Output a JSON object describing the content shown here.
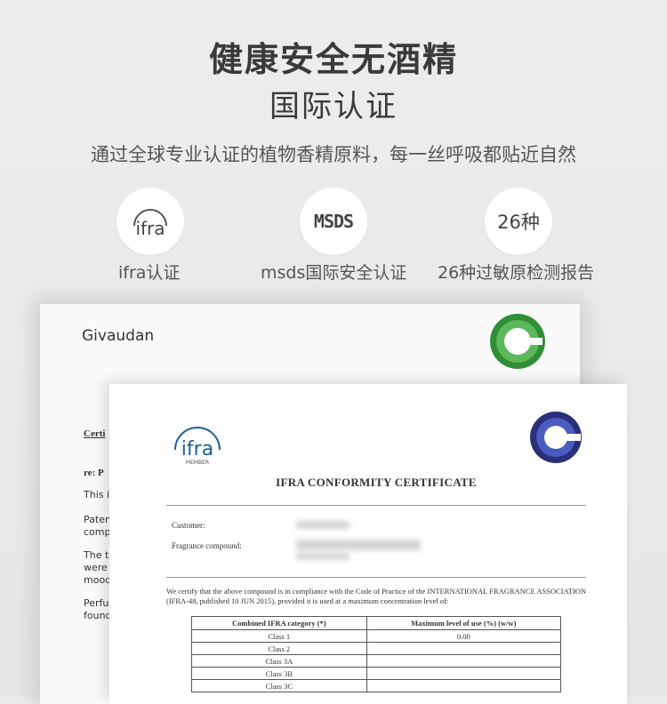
{
  "header": {
    "title": "健康安全无酒精",
    "subtitle": "国际认证",
    "description": "通过全球专业认证的植物香精原料，每一丝呼吸都贴近自然"
  },
  "badges": [
    {
      "icon_text": "ifra",
      "label": "ifra认证"
    },
    {
      "icon_text": "MSDS",
      "label": "msds国际安全认证"
    },
    {
      "icon_text": "26种",
      "label": "26种过敏原检测报告"
    }
  ],
  "back_certificate": {
    "company": "Givaudan",
    "fragments": [
      "Certi",
      "re: P",
      "This i",
      "Paten",
      "comp",
      "The t",
      "were",
      "mood",
      "Perfu",
      "found"
    ]
  },
  "front_certificate": {
    "logo_text": "ifra",
    "logo_sub": "MEMBER",
    "title": "IFRA CONFORMITY CERTIFICATE",
    "customer_label": "Customer:",
    "compound_label": "Fragrance compound:",
    "certify_text": "We certify that the above compound is in compliance with the Code of Practice of the INTERNATIONAL FRAGRANCE ASSOCIATION (IFRA-48, published 10 JUN 2015), provided it is used at a maximum concentration level of:",
    "table": {
      "headers": [
        "Combined IFRA category (*)",
        "Maximum level of use (%) (w/w)"
      ],
      "rows": [
        {
          "category": "Class 1",
          "level": "0.00"
        },
        {
          "category": "Class 2",
          "level": ""
        },
        {
          "category": "Class 3A",
          "level": ""
        },
        {
          "category": "Class 3B",
          "level": ""
        },
        {
          "category": "Class 3C",
          "level": ""
        }
      ]
    }
  },
  "colors": {
    "background": "#eaeaea",
    "title": "#3a3a3a",
    "ifra_blue": "#1b5f9e",
    "giv_green": "#3a9a3a"
  }
}
